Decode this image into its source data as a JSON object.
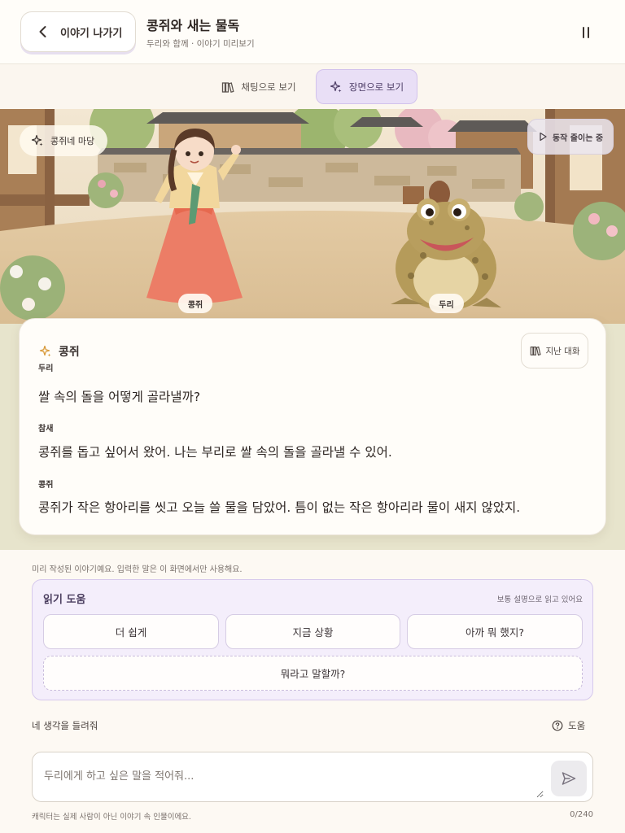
{
  "header": {
    "back_label": "이야기 나가기",
    "title": "콩쥐와 새는 물독",
    "subtitle": "두리와 함께 · 이야기 미리보기"
  },
  "tabs": [
    {
      "label": "채팅으로 보기",
      "icon": "books-icon",
      "active": false
    },
    {
      "label": "장면으로 보기",
      "icon": "sparkle-icon",
      "active": true
    }
  ],
  "scene": {
    "place": "콩쥐네 마당",
    "motion_label": "동작 줄이는 중",
    "characters": [
      "콩쥐",
      "두리"
    ]
  },
  "dialog": {
    "current_speaker": "콩쥐",
    "history_label": "지난 대화",
    "cut_speaker": "두리",
    "messages": [
      {
        "speaker": "",
        "text": "쌀 속의 돌을 어떻게 골라낼까?"
      },
      {
        "speaker": "참새",
        "text": "콩쥐를 돕고 싶어서 왔어. 나는 부리로 쌀 속의 돌을 골라낼 수 있어."
      },
      {
        "speaker": "콩쥐",
        "text": "콩쥐가 작은 항아리를 씻고 오늘 쓸 물을 담았어. 틈이 없는 작은 항아리라 물이 새지 않았지."
      }
    ]
  },
  "notice": "미리 작성된 이야기예요. 입력한 말은 이 화면에서만 사용해요.",
  "reading_help": {
    "title": "읽기 도움",
    "status": "보통 설명으로 읽고 있어요",
    "options": [
      "더 쉽게",
      "지금 상황",
      "아까 뭐 했지?"
    ],
    "suggest": "뭐라고 말할까?"
  },
  "composer": {
    "label": "네 생각을 들려줘",
    "help_label": "도움",
    "placeholder": "두리에게 하고 싶은 말을 적어줘...",
    "disclaimer": "캐릭터는 실제 사람이 아닌 이야기 속 인물이에요.",
    "counter": "0/240"
  },
  "colors": {
    "accent": "#e9dff6",
    "accent_border": "#d2c2ec",
    "background": "#fdf9f3"
  }
}
